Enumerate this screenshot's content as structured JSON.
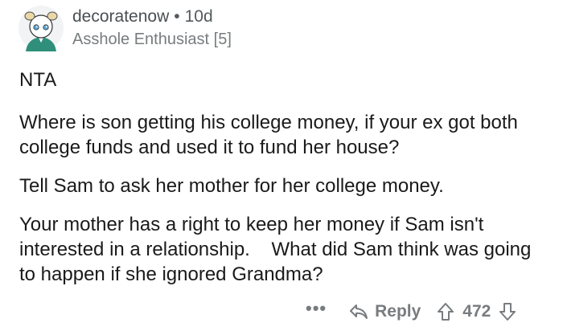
{
  "comment": {
    "username": "decoratenow",
    "separator": "•",
    "age": "10d",
    "flair": "Asshole Enthusiast [5]",
    "paragraphs": [
      "NTA",
      "Where is son getting his college money, if your ex got both college funds and used it to fund her house?",
      "Tell Sam to ask her mother for her college money.",
      "Your mother has a right to keep her money if Sam isn't interested in a relationship.    What did Sam think was going to happen if she ignored Grandma?"
    ],
    "actions": {
      "more": "•••",
      "reply_label": "Reply",
      "score": "472"
    }
  },
  "icons": {
    "avatar": "avatar-icon",
    "reply": "reply-arrow-icon",
    "upvote": "upvote-arrow-icon",
    "downvote": "downvote-arrow-icon"
  },
  "colors": {
    "text": "#1a1a1b",
    "meta": "#787c7e",
    "avatar_shirt": "#2f8f7a"
  }
}
